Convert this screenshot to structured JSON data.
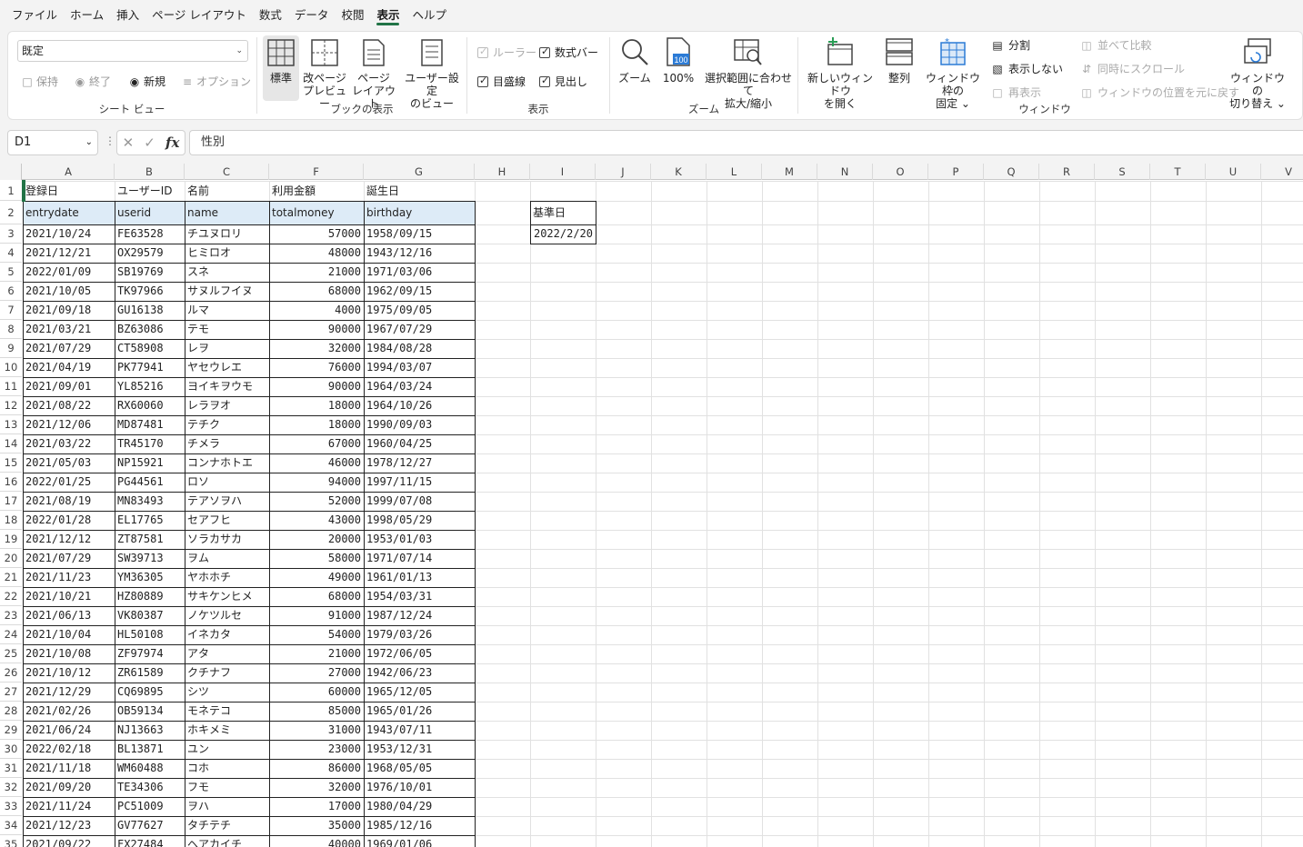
{
  "menu": [
    "ファイル",
    "ホーム",
    "挿入",
    "ページ レイアウト",
    "数式",
    "データ",
    "校閲",
    "表示",
    "ヘルプ"
  ],
  "menu_active": "表示",
  "ribbon": {
    "sheetview": {
      "select_value": "既定",
      "keep": "保持",
      "exit": "終了",
      "new": "新規",
      "options": "オプション",
      "label": "シート ビュー"
    },
    "bookview": {
      "normal": "標準",
      "pagebreak_1": "改ページ",
      "pagebreak_2": "プレビュー",
      "pagelayout_1": "ページ",
      "pagelayout_2": "レイアウト",
      "custom_1": "ユーザー設定",
      "custom_2": "のビュー",
      "label": "ブックの表示"
    },
    "show": {
      "ruler": "ルーラー",
      "formula_bar": "数式バー",
      "gridlines": "目盛線",
      "headings": "見出し",
      "label": "表示"
    },
    "zoom": {
      "zoom": "ズーム",
      "hundred": "100%",
      "hundred_icon": "100",
      "fit_1": "選択範囲に合わせて",
      "fit_2": "拡大/縮小",
      "label": "ズーム"
    },
    "window": {
      "new_window_1": "新しいウィンドウ",
      "new_window_2": "を開く",
      "arrange": "整列",
      "freeze_1": "ウィンドウ枠の",
      "freeze_2": "固定 ⌄",
      "split": "分割",
      "hide": "表示しない",
      "unhide": "再表示",
      "side_by_side": "並べて比較",
      "sync_scroll": "同時にスクロール",
      "reset_pos": "ウィンドウの位置を元に戻す",
      "switch_1": "ウィンドウの",
      "switch_2": "切り替え ⌄",
      "label": "ウィンドウ"
    }
  },
  "formula_bar": {
    "name_box": "D1",
    "content": "性別"
  },
  "columns": [
    "A",
    "B",
    "C",
    "F",
    "G",
    "H",
    "I",
    "J",
    "K",
    "L",
    "M",
    "N",
    "O",
    "P",
    "Q",
    "R",
    "S",
    "T",
    "U",
    "V"
  ],
  "row_numbers": [
    "1",
    "2",
    "3",
    "4",
    "5",
    "6",
    "7",
    "8",
    "9",
    "10",
    "11",
    "12",
    "13",
    "14",
    "15",
    "16",
    "17",
    "18",
    "19",
    "20",
    "21",
    "22",
    "23",
    "24",
    "25",
    "26",
    "27",
    "28",
    "29",
    "30",
    "31",
    "32",
    "33",
    "34",
    "35"
  ],
  "sheet": {
    "header_jp": [
      "登録日",
      "ユーザーID",
      "名前",
      "利用金額",
      "誕生日"
    ],
    "header_en": [
      "entrydate",
      "userid",
      "name",
      "totalmoney",
      "birthday"
    ],
    "rows": [
      [
        "2021/10/24",
        "FE63528",
        "チユヌロリ",
        "57000",
        "1958/09/15"
      ],
      [
        "2021/12/21",
        "OX29579",
        "ヒミロオ",
        "48000",
        "1943/12/16"
      ],
      [
        "2022/01/09",
        "SB19769",
        "スネ",
        "21000",
        "1971/03/06"
      ],
      [
        "2021/10/05",
        "TK97966",
        "サヌルフイヌ",
        "68000",
        "1962/09/15"
      ],
      [
        "2021/09/18",
        "GU16138",
        "ルマ",
        "4000",
        "1975/09/05"
      ],
      [
        "2021/03/21",
        "BZ63086",
        "テモ",
        "90000",
        "1967/07/29"
      ],
      [
        "2021/07/29",
        "CT58908",
        "レヲ",
        "32000",
        "1984/08/28"
      ],
      [
        "2021/04/19",
        "PK77941",
        "ヤセウレエ",
        "76000",
        "1994/03/07"
      ],
      [
        "2021/09/01",
        "YL85216",
        "ヨイキヲウモ",
        "90000",
        "1964/03/24"
      ],
      [
        "2021/08/22",
        "RX60060",
        "レラヲオ",
        "18000",
        "1964/10/26"
      ],
      [
        "2021/12/06",
        "MD87481",
        "テチク",
        "18000",
        "1990/09/03"
      ],
      [
        "2021/03/22",
        "TR45170",
        "チメラ",
        "67000",
        "1960/04/25"
      ],
      [
        "2021/05/03",
        "NP15921",
        "コンナホトエ",
        "46000",
        "1978/12/27"
      ],
      [
        "2022/01/25",
        "PG44561",
        "ロソ",
        "94000",
        "1997/11/15"
      ],
      [
        "2021/08/19",
        "MN83493",
        "テアソヲハ",
        "52000",
        "1999/07/08"
      ],
      [
        "2022/01/28",
        "EL17765",
        "セアフヒ",
        "43000",
        "1998/05/29"
      ],
      [
        "2021/12/12",
        "ZT87581",
        "ソラカサカ",
        "20000",
        "1953/01/03"
      ],
      [
        "2021/07/29",
        "SW39713",
        "ヲム",
        "58000",
        "1971/07/14"
      ],
      [
        "2021/11/23",
        "YM36305",
        "ヤホホチ",
        "49000",
        "1961/01/13"
      ],
      [
        "2021/10/21",
        "HZ80889",
        "サキケンヒメ",
        "68000",
        "1954/03/31"
      ],
      [
        "2021/06/13",
        "VK80387",
        "ノケツルセ",
        "91000",
        "1987/12/24"
      ],
      [
        "2021/10/04",
        "HL50108",
        "イネカタ",
        "54000",
        "1979/03/26"
      ],
      [
        "2021/10/08",
        "ZF97974",
        "アタ",
        "21000",
        "1972/06/05"
      ],
      [
        "2021/10/12",
        "ZR61589",
        "クチナフ",
        "27000",
        "1942/06/23"
      ],
      [
        "2021/12/29",
        "CQ69895",
        "シツ",
        "60000",
        "1965/12/05"
      ],
      [
        "2021/02/26",
        "OB59134",
        "モネテコ",
        "85000",
        "1965/01/26"
      ],
      [
        "2021/06/24",
        "NJ13663",
        "ホキメミ",
        "31000",
        "1943/07/11"
      ],
      [
        "2022/02/18",
        "BL13871",
        "ユン",
        "23000",
        "1953/12/31"
      ],
      [
        "2021/11/18",
        "WM60488",
        "コホ",
        "86000",
        "1968/05/05"
      ],
      [
        "2021/09/20",
        "TE34306",
        "フモ",
        "32000",
        "1976/10/01"
      ],
      [
        "2021/11/24",
        "PC51009",
        "ヲハ",
        "17000",
        "1980/04/29"
      ],
      [
        "2021/12/23",
        "GV77627",
        "タチテチ",
        "35000",
        "1985/12/16"
      ],
      [
        "2021/09/22",
        "FX27484",
        "ヘアカイチ",
        "40000",
        "1969/01/06"
      ]
    ],
    "ref_label": "基準日",
    "ref_value": "2022/2/20"
  }
}
